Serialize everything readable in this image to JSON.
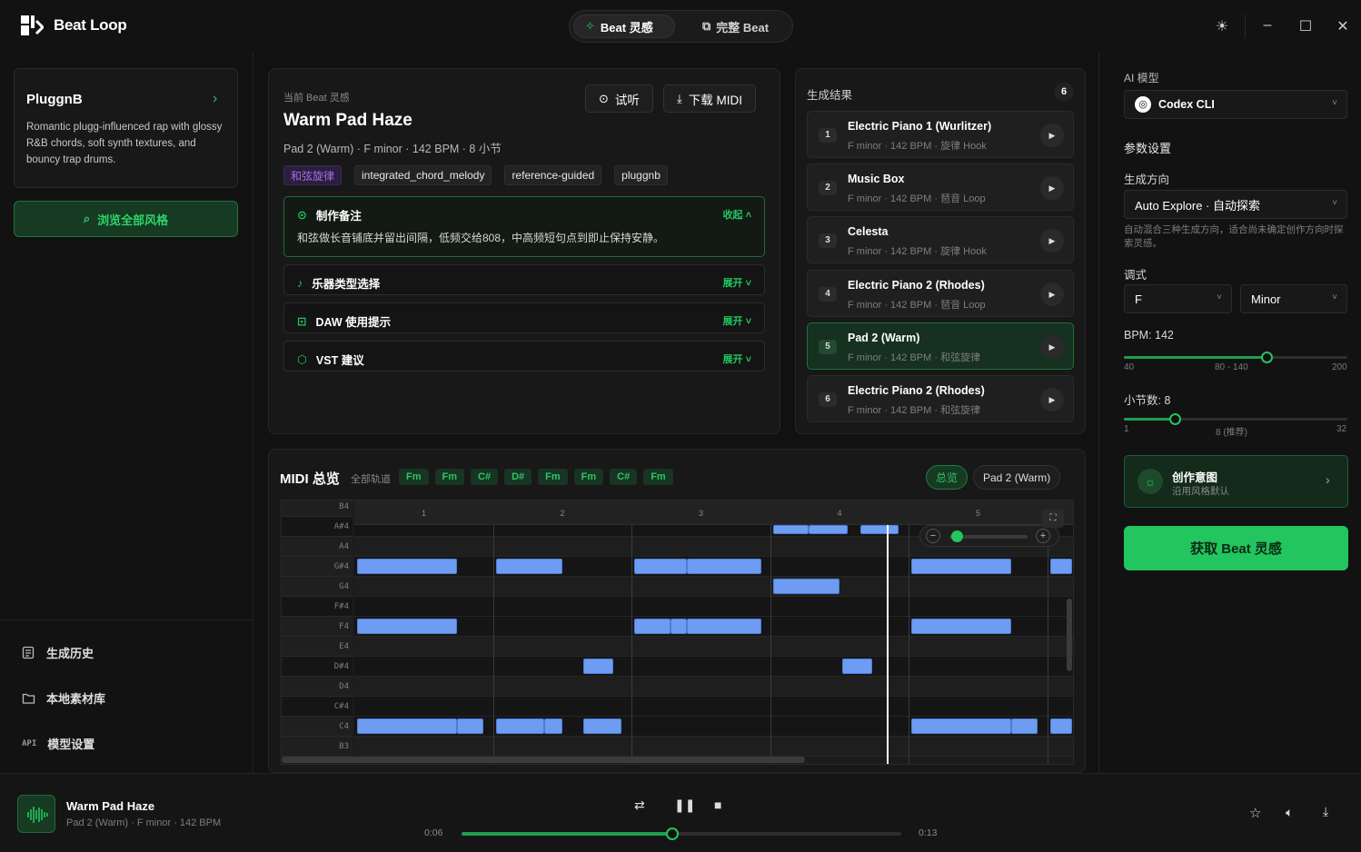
{
  "app": {
    "title": "Beat Loop",
    "tabs": [
      {
        "label": "Beat 灵感",
        "active": true
      },
      {
        "label": "完整 Beat",
        "active": false
      }
    ]
  },
  "sidebar": {
    "style": {
      "name": "PluggnB",
      "description": "Romantic plugg-influenced rap with glossy R&B chords, soft synth textures, and bouncy trap drums."
    },
    "browse_label": "浏览全部风格",
    "nav": [
      {
        "label": "生成历史",
        "icon": "history-icon"
      },
      {
        "label": "本地素材库",
        "icon": "folder-icon"
      },
      {
        "label": "模型设置",
        "icon": "api-icon"
      }
    ],
    "api_badge": "API"
  },
  "detail": {
    "eyebrow": "当前 Beat 灵感",
    "title": "Warm Pad Haze",
    "subtitle": "Pad 2 (Warm) · F minor · 142 BPM · 8 小节",
    "preview_label": "试听",
    "download_label": "下载 MIDI",
    "tags": [
      "和弦旋律",
      "integrated_chord_melody",
      "reference-guided",
      "pluggnb"
    ],
    "notes": {
      "title": "制作备注",
      "toggle": "收起",
      "body": "和弦做长音铺底并留出间隔，低频交给808，中高频短句点到即止保持安静。"
    },
    "sections": [
      {
        "title": "乐器类型选择",
        "toggle": "展开",
        "icon": "music-note-icon"
      },
      {
        "title": "DAW 使用提示",
        "toggle": "展开",
        "icon": "daw-icon"
      },
      {
        "title": "VST 建议",
        "toggle": "展开",
        "icon": "hexagon-icon"
      }
    ]
  },
  "results": {
    "title": "生成结果",
    "count": "6",
    "items": [
      {
        "num": "1",
        "name": "Electric Piano 1 (Wurlitzer)",
        "meta": "F minor · 142 BPM · 旋律 Hook",
        "active": false
      },
      {
        "num": "2",
        "name": "Music Box",
        "meta": "F minor · 142 BPM · 琶音 Loop",
        "active": false
      },
      {
        "num": "3",
        "name": "Celesta",
        "meta": "F minor · 142 BPM · 旋律 Hook",
        "active": false
      },
      {
        "num": "4",
        "name": "Electric Piano 2 (Rhodes)",
        "meta": "F minor · 142 BPM · 琶音 Loop",
        "active": false
      },
      {
        "num": "5",
        "name": "Pad 2 (Warm)",
        "meta": "F minor · 142 BPM · 和弦旋律",
        "active": true
      },
      {
        "num": "6",
        "name": "Electric Piano 2 (Rhodes)",
        "meta": "F minor · 142 BPM · 和弦旋律",
        "active": false
      }
    ]
  },
  "midi": {
    "title": "MIDI 总览",
    "subtitle": "全部轨道",
    "chords": [
      "Fm",
      "Fm",
      "C#",
      "D#",
      "Fm",
      "Fm",
      "C#",
      "Fm"
    ],
    "overview_label": "总览",
    "track_label": "Pad 2 (Warm)",
    "keys": [
      "B4",
      "A#4",
      "A4",
      "G#4",
      "G4",
      "F#4",
      "F4",
      "E4",
      "D#4",
      "D4",
      "C#4",
      "C4",
      "B3"
    ],
    "bars": [
      "1",
      "2",
      "3",
      "4",
      "5"
    ],
    "notes": [
      {
        "pitch": "A#4",
        "start": 3.0,
        "len": 0.26
      },
      {
        "pitch": "A#4",
        "start": 3.26,
        "len": 0.28
      },
      {
        "pitch": "A#4",
        "start": 3.63,
        "len": 0.28
      },
      {
        "pitch": "G#4",
        "start": 0.0,
        "len": 0.72
      },
      {
        "pitch": "G#4",
        "start": 1.0,
        "len": 0.48
      },
      {
        "pitch": "G#4",
        "start": 2.0,
        "len": 0.38
      },
      {
        "pitch": "G#4",
        "start": 2.38,
        "len": 0.54
      },
      {
        "pitch": "G#4",
        "start": 4.0,
        "len": 0.72
      },
      {
        "pitch": "G#4",
        "start": 5.0,
        "len": 0.16
      },
      {
        "pitch": "G4",
        "start": 3.0,
        "len": 0.48
      },
      {
        "pitch": "F4",
        "start": 0.0,
        "len": 0.72
      },
      {
        "pitch": "F4",
        "start": 2.0,
        "len": 0.26
      },
      {
        "pitch": "F4",
        "start": 2.26,
        "len": 0.12
      },
      {
        "pitch": "F4",
        "start": 2.38,
        "len": 0.54
      },
      {
        "pitch": "F4",
        "start": 4.0,
        "len": 0.72
      },
      {
        "pitch": "D#4",
        "start": 1.63,
        "len": 0.22
      },
      {
        "pitch": "D#4",
        "start": 3.5,
        "len": 0.22
      },
      {
        "pitch": "C4",
        "start": 0.0,
        "len": 0.72
      },
      {
        "pitch": "C4",
        "start": 0.72,
        "len": 0.19
      },
      {
        "pitch": "C4",
        "start": 1.0,
        "len": 0.35
      },
      {
        "pitch": "C4",
        "start": 1.35,
        "len": 0.13
      },
      {
        "pitch": "C4",
        "start": 1.63,
        "len": 0.28
      },
      {
        "pitch": "C4",
        "start": 4.0,
        "len": 0.72
      },
      {
        "pitch": "C4",
        "start": 4.72,
        "len": 0.19
      },
      {
        "pitch": "C4",
        "start": 5.0,
        "len": 0.16
      }
    ],
    "playhead": 3.84
  },
  "settings": {
    "ai_model_label": "AI 模型",
    "ai_model": "Codex CLI",
    "params_label": "参数设置",
    "direction_label": "生成方向",
    "direction": "Auto Explore · 自动探索",
    "direction_hint": "自动混合三种生成方向，适合尚未确定创作方向时探索灵感。",
    "key_label": "调式",
    "key_root": "F",
    "key_mode": "Minor",
    "bpm_label": "BPM: 142",
    "bpm": {
      "min": 40,
      "max": 200,
      "value": 142
    },
    "bpm_ticks": [
      "40",
      "80 - 140",
      "200"
    ],
    "bars_label": "小节数: 8",
    "bars": {
      "min": 1,
      "max": 32,
      "value": 8
    },
    "bars_ticks": [
      "1",
      "8 (推荐)",
      "32"
    ],
    "intent_title": "创作意图",
    "intent_sub": "沿用风格默认",
    "cta": "获取 Beat 灵感"
  },
  "player": {
    "title": "Warm Pad Haze",
    "meta": "Pad 2 (Warm) · F minor · 142 BPM",
    "current": "0:06",
    "total": "0:13",
    "progress": 0.48
  },
  "colors": {
    "accent": "#22c55e",
    "note": "#6d9cf2",
    "tag_purple": "#a66cf0"
  }
}
